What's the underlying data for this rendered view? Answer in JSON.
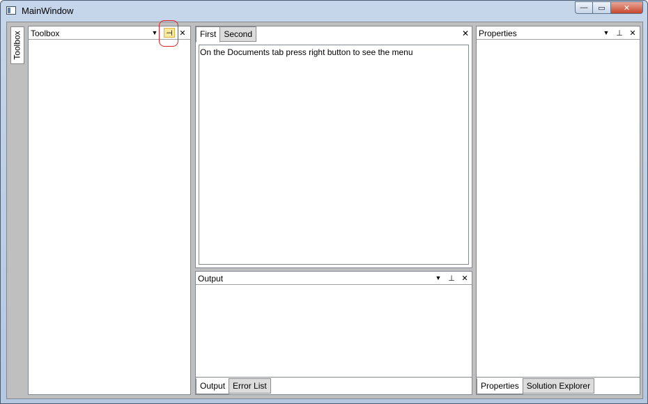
{
  "window": {
    "title": "MainWindow",
    "controls": {
      "minimize": "—",
      "maximize": "▭",
      "close": "✕"
    }
  },
  "side_tab": {
    "label": "Toolbox"
  },
  "toolbox": {
    "title": "Toolbox",
    "dropdown_icon": "▼",
    "pin_icon": "⊣",
    "close_icon": "✕"
  },
  "documents": {
    "tabs": [
      {
        "label": "First",
        "active": true
      },
      {
        "label": "Second",
        "active": false
      }
    ],
    "close_icon": "✕",
    "content": "On the Documents tab press right button to see the menu"
  },
  "output": {
    "title": "Output",
    "dropdown_icon": "▼",
    "pin_icon": "⊥",
    "close_icon": "✕",
    "tabs": [
      {
        "label": "Output",
        "active": true
      },
      {
        "label": "Error List",
        "active": false
      }
    ]
  },
  "properties": {
    "title": "Properties",
    "dropdown_icon": "▼",
    "pin_icon": "⊥",
    "close_icon": "✕",
    "tabs": [
      {
        "label": "Properties",
        "active": true
      },
      {
        "label": "Solution Explorer",
        "active": false
      }
    ]
  },
  "colors": {
    "highlight": "#fbe89a",
    "annotation": "#e0202a",
    "background": "#bfbfbf"
  }
}
